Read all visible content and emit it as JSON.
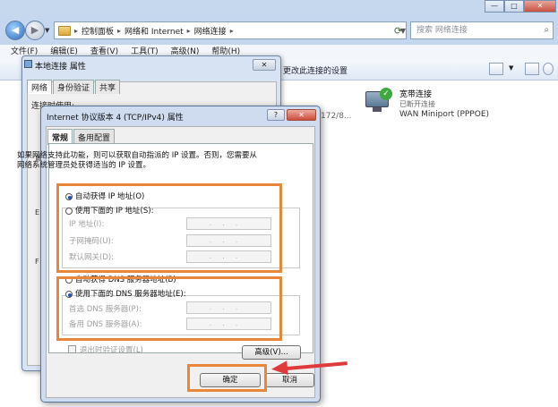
{
  "explorer": {
    "caption_buttons": {
      "minimize": "—",
      "maximize": "□",
      "close": "✕"
    },
    "breadcrumbs": [
      "控制面板",
      "网络和 Internet",
      "网络连接"
    ],
    "search_placeholder": "搜索 网络连接",
    "menu": [
      "文件(F)",
      "编辑(E)",
      "查看(V)",
      "工具(T)",
      "高级(N)",
      "帮助(H)"
    ],
    "toolbar_text": "更改此连接的设置",
    "background_partial_text": "172/8...",
    "connection": {
      "name": "宽带连接",
      "status": "已断开连接",
      "device": "WAN Miniport (PPPOE)"
    }
  },
  "props_dialog": {
    "title": "本地连接 属性",
    "close": "✕",
    "tabs": [
      "网络",
      "身份验证",
      "共享"
    ],
    "connect_using_label": "连接时使用:",
    "side_glyphs": [
      "此",
      "E",
      "F"
    ]
  },
  "ipv4_dialog": {
    "title": "Internet 协议版本 4 (TCP/IPv4) 属性",
    "help": "?",
    "close": "✕",
    "tabs": [
      "常规",
      "备用配置"
    ],
    "description": "如果网络支持此功能，则可以获取自动指派的 IP 设置。否则，您需要从网络系统管理员处获得适当的 IP 设置。",
    "ip_auto_label": "自动获得 IP 地址(O)",
    "ip_manual_label": "使用下面的 IP 地址(S):",
    "ip_fields": {
      "ip_address": "IP 地址(I):",
      "subnet_mask": "子网掩码(U):",
      "default_gateway": "默认网关(D):"
    },
    "dns_auto_label": "自动获得 DNS 服务器地址(B)",
    "dns_manual_label": "使用下面的 DNS 服务器地址(E):",
    "dns_fields": {
      "preferred": "首选 DNS 服务器(P):",
      "alternate": "备用 DNS 服务器(A):"
    },
    "ip_placeholder": "...",
    "validate_label": "退出时验证设置(L)",
    "advanced_button": "高级(V)...",
    "ok_button": "确定",
    "cancel_button": "取消"
  },
  "colors": {
    "highlight_box": "#e8873a",
    "arrow": "#e03a3c",
    "explorer_frame": "#c6d8ee"
  }
}
